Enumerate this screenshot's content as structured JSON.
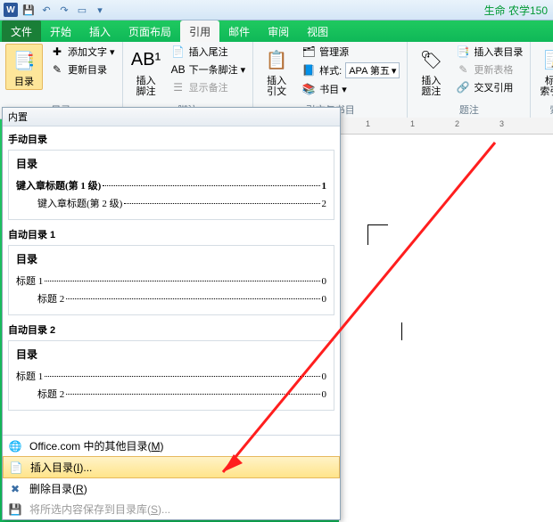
{
  "titlebar": {
    "doc_title": "生命 农学150"
  },
  "tabs": [
    "文件",
    "开始",
    "插入",
    "页面布局",
    "引用",
    "邮件",
    "审阅",
    "视图"
  ],
  "ribbon": {
    "toc": {
      "button": "目录",
      "add_text": "添加文字 ▾",
      "update": "更新目录",
      "label": "目录"
    },
    "footnotes": {
      "insert": "插入脚注",
      "endnote": "插入尾注",
      "next": "下一条脚注 ▾",
      "show": "显示备注",
      "label": "脚注"
    },
    "citations": {
      "insert": "插入引文",
      "manage": "管理源",
      "style_label": "样式:",
      "style_value": "APA 第五",
      "bibliography": "书目 ▾",
      "label": "引文与书目"
    },
    "captions": {
      "insert": "插入题注",
      "table_of_figures": "插入表目录",
      "update_table": "更新表格",
      "cross_ref": "交叉引用",
      "label": "题注"
    },
    "index": {
      "mark": "标记\n索引项",
      "label": "索"
    }
  },
  "ruler": [
    "1",
    "1",
    "2",
    "3"
  ],
  "gallery": {
    "header": "内置",
    "sections": [
      {
        "title": "手动目录",
        "heading": "目录",
        "rows": [
          {
            "text": "键入章标题(第 1 级)",
            "page": "1"
          },
          {
            "text": "键入章标题(第 2 级)",
            "page": "2"
          }
        ]
      },
      {
        "title": "自动目录 1",
        "heading": "目录",
        "rows": [
          {
            "text": "标题 1",
            "page": "0"
          },
          {
            "text": "标题 2",
            "page": "0"
          }
        ]
      },
      {
        "title": "自动目录 2",
        "heading": "目录",
        "rows": [
          {
            "text": "标题 1",
            "page": "0"
          },
          {
            "text": "标题 2",
            "page": "0"
          }
        ]
      }
    ],
    "menu": [
      {
        "text": "Office.com 中的其他目录",
        "key": "M"
      },
      {
        "text": "插入目录",
        "key": "I"
      },
      {
        "text": "删除目录",
        "key": "R"
      },
      {
        "text": "将所选内容保存到目录库",
        "key": "S"
      }
    ]
  }
}
